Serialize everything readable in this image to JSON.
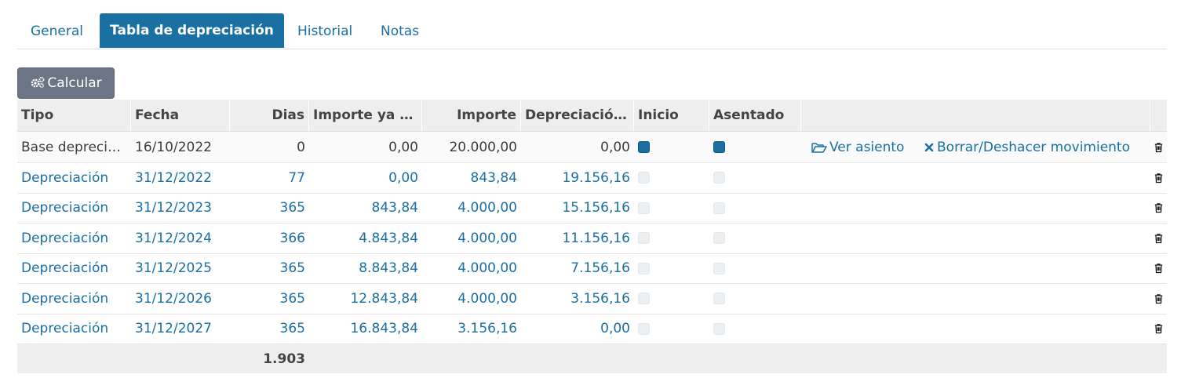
{
  "tabs": {
    "general": "General",
    "depreciation": "Tabla de depreciación",
    "history": "Historial",
    "notes": "Notas"
  },
  "toolbar": {
    "calculate_label": "Calcular",
    "calculate_icon": "gears-icon"
  },
  "columns": {
    "tipo": "Tipo",
    "fecha": "Fecha",
    "dias": "Dias",
    "importe_ya": "Importe ya d…",
    "importe": "Importe",
    "depreciacion": "Depreciación…",
    "inicio": "Inicio",
    "asentado": "Asentado"
  },
  "rows": [
    {
      "tipo": "Base depreci…",
      "fecha": "16/10/2022",
      "dias": "0",
      "importe_ya": "0,00",
      "importe": "20.000,00",
      "depreciacion": "0,00",
      "inicio": true,
      "asentado": true,
      "view_label": "Ver asiento",
      "undo_label": "Borrar/Deshacer movimiento"
    },
    {
      "tipo": "Depreciación",
      "fecha": "31/12/2022",
      "dias": "77",
      "importe_ya": "0,00",
      "importe": "843,84",
      "depreciacion": "19.156,16",
      "inicio": false,
      "asentado": false
    },
    {
      "tipo": "Depreciación",
      "fecha": "31/12/2023",
      "dias": "365",
      "importe_ya": "843,84",
      "importe": "4.000,00",
      "depreciacion": "15.156,16",
      "inicio": false,
      "asentado": false
    },
    {
      "tipo": "Depreciación",
      "fecha": "31/12/2024",
      "dias": "366",
      "importe_ya": "4.843,84",
      "importe": "4.000,00",
      "depreciacion": "11.156,16",
      "inicio": false,
      "asentado": false
    },
    {
      "tipo": "Depreciación",
      "fecha": "31/12/2025",
      "dias": "365",
      "importe_ya": "8.843,84",
      "importe": "4.000,00",
      "depreciacion": "7.156,16",
      "inicio": false,
      "asentado": false
    },
    {
      "tipo": "Depreciación",
      "fecha": "31/12/2026",
      "dias": "365",
      "importe_ya": "12.843,84",
      "importe": "4.000,00",
      "depreciacion": "3.156,16",
      "inicio": false,
      "asentado": false
    },
    {
      "tipo": "Depreciación",
      "fecha": "31/12/2027",
      "dias": "365",
      "importe_ya": "16.843,84",
      "importe": "3.156,16",
      "depreciacion": "0,00",
      "inicio": false,
      "asentado": false
    }
  ],
  "footer": {
    "dias_total": "1.903"
  },
  "colors": {
    "accent": "#1a6fa3",
    "button": "#6c7586",
    "header_bg": "#eeeeee"
  }
}
